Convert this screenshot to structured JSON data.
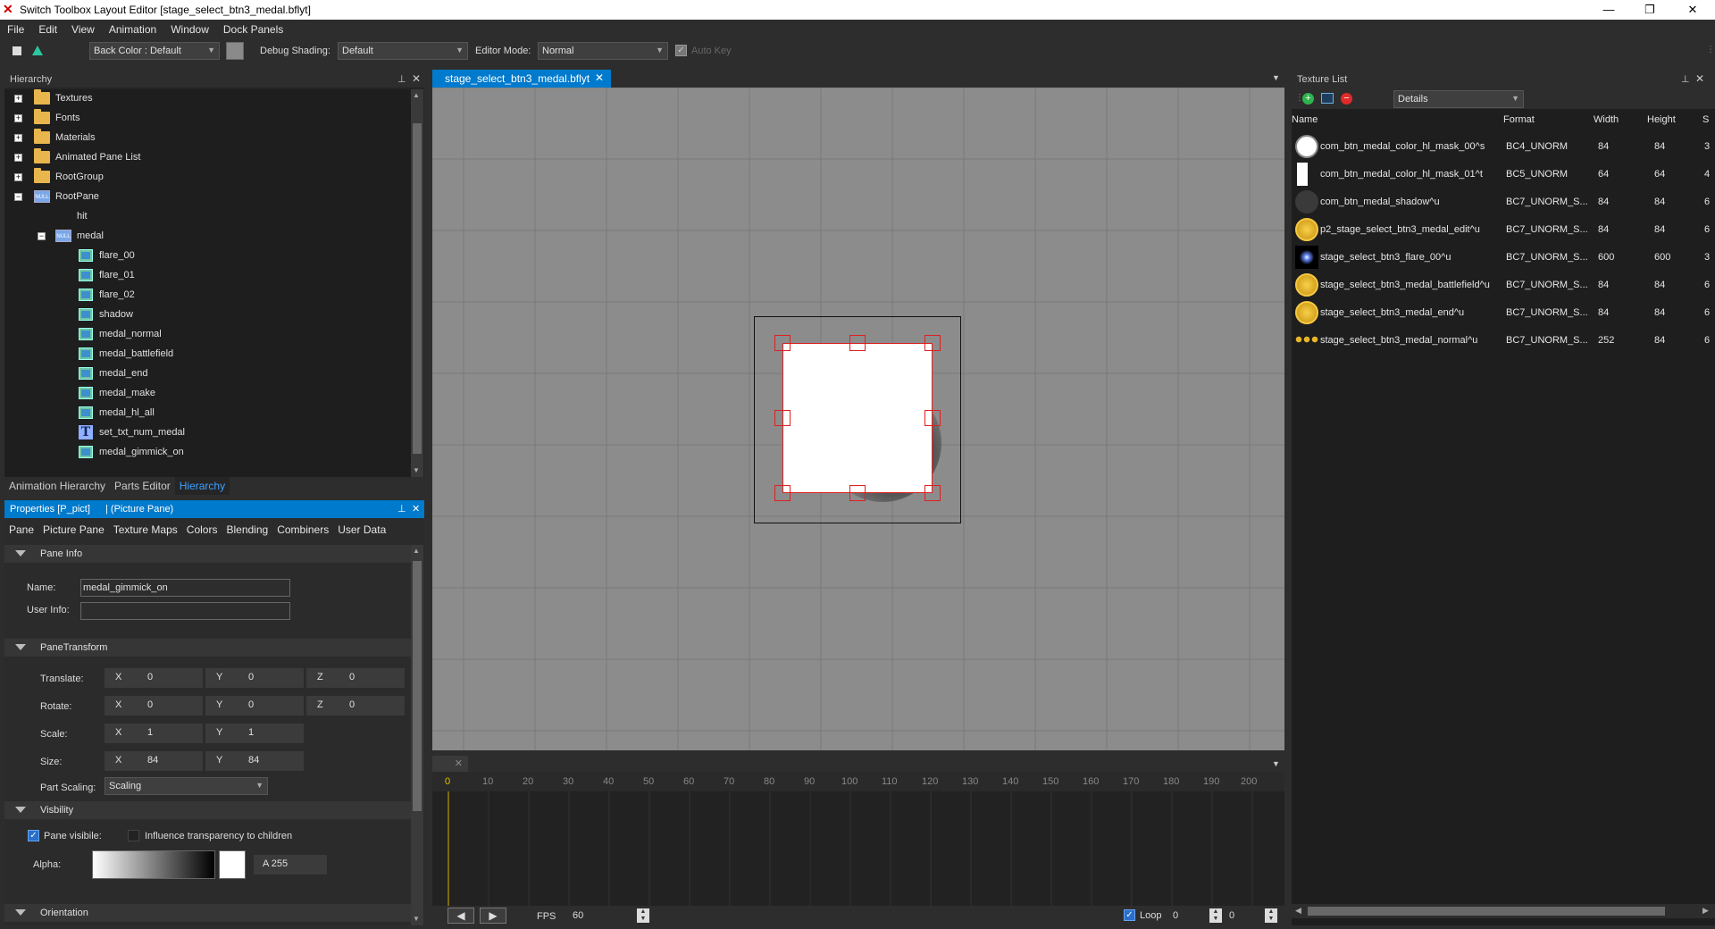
{
  "titlebar": {
    "title": "Switch Toolbox Layout Editor [stage_select_btn3_medal.bflyt]",
    "minimize": "—",
    "maximize": "❐",
    "close": "✕"
  },
  "menu": [
    "File",
    "Edit",
    "View",
    "Animation",
    "Window",
    "Dock Panels"
  ],
  "toolbar": {
    "back_color": "Back Color : Default",
    "debug_label": "Debug Shading:",
    "debug_value": "Default",
    "mode_label": "Editor Mode:",
    "mode_value": "Normal",
    "autokey": "Auto Key"
  },
  "hierarchy": {
    "title": "Hierarchy",
    "items": [
      "Textures",
      "Fonts",
      "Materials",
      "Animated Pane List",
      "RootGroup",
      "RootPane",
      "hit",
      "medal",
      "flare_00",
      "flare_01",
      "flare_02",
      "shadow",
      "medal_normal",
      "medal_battlefield",
      "medal_end",
      "medal_make",
      "medal_hl_all",
      "set_txt_num_medal",
      "medal_gimmick_on"
    ],
    "bottom_tabs": [
      "Animation Hierarchy",
      "Parts Editor",
      "Hierarchy"
    ],
    "null_icon": "NULL"
  },
  "properties": {
    "title": "Properties [P_pict]",
    "title2": "|   (Picture Pane)",
    "tabs": [
      "Pane",
      "Picture Pane",
      "Texture Maps",
      "Colors",
      "Blending",
      "Combiners",
      "User Data"
    ],
    "sections": {
      "pane_info": "Pane Info",
      "transform": "PaneTransform",
      "visibility": "Visbility",
      "orientation": "Orientation"
    },
    "name_label": "Name:",
    "name_value": "medal_gimmick_on",
    "userinfo_label": "User Info:",
    "userinfo_value": "",
    "translate_label": "Translate:",
    "rotate_label": "Rotate:",
    "scale_label": "Scale:",
    "size_label": "Size:",
    "partscaling_label": "Part Scaling:",
    "partscaling_value": "Scaling",
    "axes": {
      "x": "X",
      "y": "Y",
      "z": "Z"
    },
    "translate": {
      "x": "0",
      "y": "0",
      "z": "0"
    },
    "rotate": {
      "x": "0",
      "y": "0",
      "z": "0"
    },
    "scale": {
      "x": "1",
      "y": "1"
    },
    "size": {
      "x": "84",
      "y": "84"
    },
    "pane_visible": "Pane visibile:",
    "influence": "Influence transparency to children",
    "alpha_label": "Alpha:",
    "alpha_value": "A   255"
  },
  "editor": {
    "tab": "stage_select_btn3_medal.bflyt"
  },
  "timeline": {
    "ticks": [
      "0",
      "10",
      "20",
      "30",
      "40",
      "50",
      "60",
      "70",
      "80",
      "90",
      "100",
      "110",
      "120",
      "130",
      "140",
      "150",
      "160",
      "170",
      "180",
      "190",
      "200"
    ],
    "fps_label": "FPS",
    "fps_value": "60",
    "loop_label": "Loop",
    "loop_value": "0",
    "frame_value": "0"
  },
  "texture_list": {
    "title": "Texture List",
    "view": "Details",
    "headers": [
      "Name",
      "Format",
      "Width",
      "Height",
      "S"
    ],
    "rows": [
      {
        "name": "com_btn_medal_color_hl_mask_00^s",
        "format": "BC4_UNORM",
        "w": "84",
        "h": "84",
        "s": "3"
      },
      {
        "name": "com_btn_medal_color_hl_mask_01^t",
        "format": "BC5_UNORM",
        "w": "64",
        "h": "64",
        "s": "4"
      },
      {
        "name": "com_btn_medal_shadow^u",
        "format": "BC7_UNORM_S...",
        "w": "84",
        "h": "84",
        "s": "6"
      },
      {
        "name": "p2_stage_select_btn3_medal_edit^u",
        "format": "BC7_UNORM_S...",
        "w": "84",
        "h": "84",
        "s": "6"
      },
      {
        "name": "stage_select_btn3_flare_00^u",
        "format": "BC7_UNORM_S...",
        "w": "600",
        "h": "600",
        "s": "3"
      },
      {
        "name": "stage_select_btn3_medal_battlefield^u",
        "format": "BC7_UNORM_S...",
        "w": "84",
        "h": "84",
        "s": "6"
      },
      {
        "name": "stage_select_btn3_medal_end^u",
        "format": "BC7_UNORM_S...",
        "w": "84",
        "h": "84",
        "s": "6"
      },
      {
        "name": "stage_select_btn3_medal_normal^u",
        "format": "BC7_UNORM_S...",
        "w": "252",
        "h": "84",
        "s": "6"
      }
    ]
  },
  "colors": {
    "accent": "#007acc",
    "selection": "#e02020",
    "canvas": "#8c8c8c"
  }
}
